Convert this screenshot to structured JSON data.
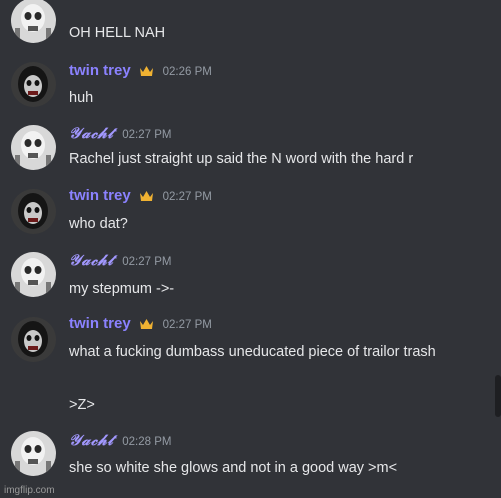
{
  "messages": [
    {
      "text": "OH HELL NAH"
    },
    {
      "user": "twin trey",
      "time": "02:26 PM",
      "text": "huh"
    },
    {
      "user": "𝒴𝒶𝒸𝒽𝓉",
      "time": "02:27 PM",
      "text": "Rachel just straight up said the N word with the hard r"
    },
    {
      "user": "twin trey",
      "time": "02:27 PM",
      "text": "who dat?"
    },
    {
      "user": "𝒴𝒶𝒸𝒽𝓉",
      "time": "02:27 PM",
      "text": "my stepmum ->-"
    },
    {
      "user": "twin trey",
      "time": "02:27 PM",
      "text": "what a fucking dumbass uneducated piece of trailor trash",
      "text2": ">Z>"
    },
    {
      "user": "𝒴𝒶𝒸𝒽𝓉",
      "time": "02:28 PM",
      "text": "she so white she glows and not in a good way >m<"
    }
  ],
  "icons": {
    "crown": "crown-icon",
    "avatar_yacht": "skull-avatar",
    "avatar_trey": "masked-face-avatar"
  },
  "colors": {
    "background": "#313338",
    "username": "#8b82ff",
    "crown": "#f0b232",
    "timestamp": "#949ba4"
  },
  "watermark": "imgflip.com"
}
